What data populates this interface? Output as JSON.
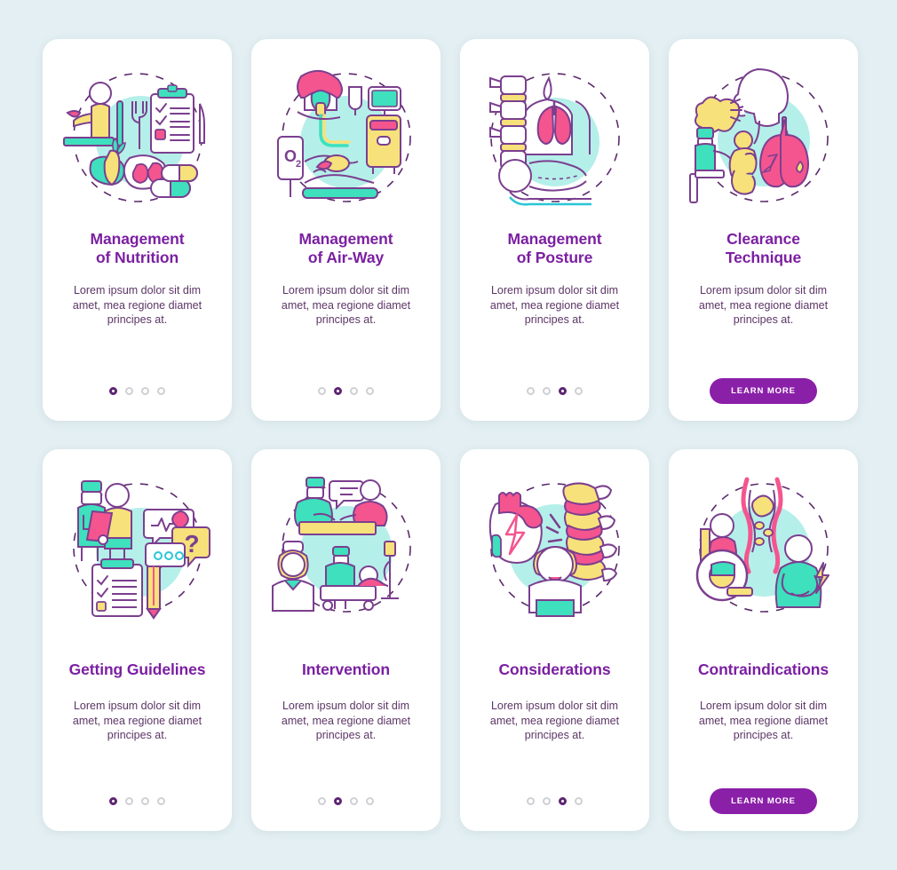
{
  "page": {
    "background_color": "#e3eff2",
    "card_background": "#ffffff",
    "title_color": "#7b1fa2",
    "body_color": "#5c3566",
    "accent_color": "#8a1fa8",
    "dot_active_color": "#5e2472",
    "dot_inactive_color": "#cfd0d4"
  },
  "palette": {
    "teal": "#3ee0bd",
    "mint": "#a9efe6",
    "pink": "#f4558f",
    "yellow": "#f7e17a",
    "outline": "#7b3f8f",
    "blue_line": "#29c6d6"
  },
  "body_text": "Lorem ipsum dolor sit dim amet, mea regione diamet principes at.",
  "learn_more_label": "LEARN MORE",
  "cards": [
    {
      "id": "management-of-nutrition",
      "title_line1": "Management",
      "title_line2": "of Nutrition",
      "illustration": "nutrition-illustration",
      "footer_type": "dots",
      "dots_total": 4,
      "dots_active_index": 0
    },
    {
      "id": "management-of-air-way",
      "title_line1": "Management",
      "title_line2": "of Air-Way",
      "illustration": "airway-illustration",
      "footer_type": "dots",
      "dots_total": 4,
      "dots_active_index": 1
    },
    {
      "id": "management-of-posture",
      "title_line1": "Management",
      "title_line2": "of Posture",
      "illustration": "posture-illustration",
      "footer_type": "dots",
      "dots_total": 4,
      "dots_active_index": 2
    },
    {
      "id": "clearance-technique",
      "title_line1": "Clearance",
      "title_line2": "Technique",
      "illustration": "clearance-technique-illustration",
      "footer_type": "button",
      "button_label": "LEARN MORE"
    },
    {
      "id": "getting-guidelines",
      "title_line1": "Getting Guidelines",
      "title_line2": "",
      "illustration": "guidelines-illustration",
      "footer_type": "dots",
      "dots_total": 4,
      "dots_active_index": 0
    },
    {
      "id": "intervention",
      "title_line1": "Intervention",
      "title_line2": "",
      "illustration": "intervention-illustration",
      "footer_type": "dots",
      "dots_total": 4,
      "dots_active_index": 1
    },
    {
      "id": "considerations",
      "title_line1": "Considerations",
      "title_line2": "",
      "illustration": "considerations-illustration",
      "footer_type": "dots",
      "dots_total": 4,
      "dots_active_index": 2
    },
    {
      "id": "contraindications",
      "title_line1": "Contraindications",
      "title_line2": "",
      "illustration": "contraindications-illustration",
      "footer_type": "button",
      "button_label": "LEARN MORE"
    }
  ]
}
